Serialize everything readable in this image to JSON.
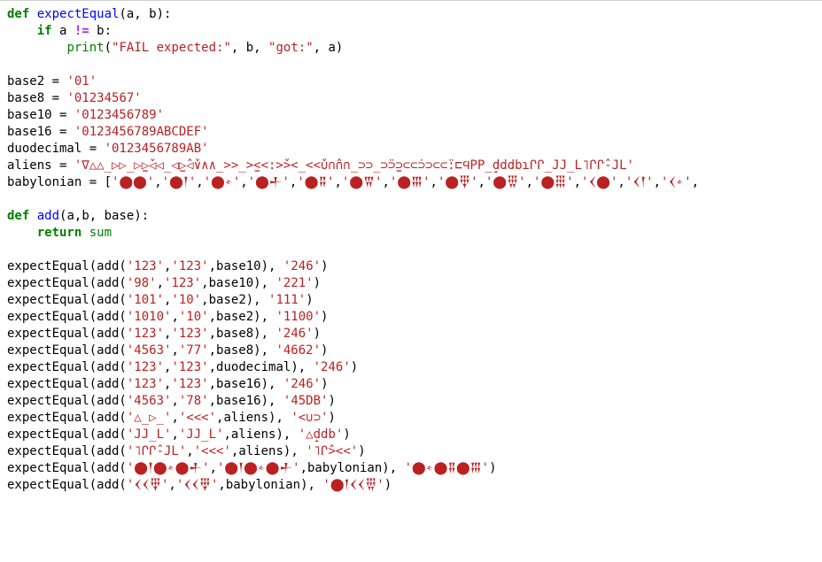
{
  "code": {
    "def1": {
      "kw_def": "def",
      "name": "expectEqual",
      "params": "(a, b):"
    },
    "if1": {
      "kw_if": "if",
      "cond_left": " a ",
      "op": "!=",
      "cond_right": " b:"
    },
    "prnt": {
      "fn": "print",
      "open": "(",
      "s1": "\"FAIL expected:\"",
      "c1": ", b, ",
      "s2": "\"got:\"",
      "c2": ", a)"
    },
    "a_base2": {
      "lhs": "base2 = ",
      "rhs": "'01'"
    },
    "a_base8": {
      "lhs": "base8 = ",
      "rhs": "'01234567'"
    },
    "a_base10": {
      "lhs": "base10 = ",
      "rhs": "'0123456789'"
    },
    "a_base16": {
      "lhs": "base16 = ",
      "rhs": "'0123456789ABCDEF'"
    },
    "a_duo": {
      "lhs": "duodecimal = ",
      "rhs": "'0123456789AB'"
    },
    "a_aliens": {
      "lhs": "aliens = ",
      "rhs": "'∇△△̲▷▷̲▷̫▷̌◁◁̲◁̫▷̂◁̌∨∧∧̲>>̲>̫<<:>̌><̲<<̌∪∩̂∩∩̲⊃⊃̲⊃̈⊃̫⊃⊂⊂̇⊃⊃⊂⊂̈:⊏ϤΡΡ̲d̝ddbɿՐՐ̲JJ̲L˥ՐՐ̂-JL'"
    },
    "a_baby": {
      "lhs": "babylonian = [",
      "items": [
        "'⬤⬤'",
        "'⬤𒑰'",
        "'⬤𒑊'",
        "'⬤𒑏'",
        "'⬤𒐉'",
        "'⬤𒐊'",
        "'⬤𒐋'",
        "'⬤𒑂'",
        "'⬤𒑄'",
        "'⬤𒑆'",
        "'𒌋⬤'",
        "'𒌋𒑰'",
        "'𒌋𒑊'"
      ],
      "tail": ","
    },
    "def2": {
      "kw_def": "def",
      "name": "add",
      "params": "(a,b, base):"
    },
    "ret": {
      "kw_ret": "return",
      "val": "sum"
    },
    "calls": [
      {
        "pre": "expectEqual(add(",
        "a": "'123'",
        "c1": ",",
        "b": "'123'",
        "c2": ",base10), ",
        "r": "'246'",
        "post": ")"
      },
      {
        "pre": "expectEqual(add(",
        "a": "'98'",
        "c1": ",",
        "b": "'123'",
        "c2": ",base10), ",
        "r": "'221'",
        "post": ")"
      },
      {
        "pre": "expectEqual(add(",
        "a": "'101'",
        "c1": ",",
        "b": "'10'",
        "c2": ",base2), ",
        "r": "'111'",
        "post": ")"
      },
      {
        "pre": "expectEqual(add(",
        "a": "'1010'",
        "c1": ",",
        "b": "'10'",
        "c2": ",base2), ",
        "r": "'1100'",
        "post": ")"
      },
      {
        "pre": "expectEqual(add(",
        "a": "'123'",
        "c1": ",",
        "b": "'123'",
        "c2": ",base8), ",
        "r": "'246'",
        "post": ")"
      },
      {
        "pre": "expectEqual(add(",
        "a": "'4563'",
        "c1": ",",
        "b": "'77'",
        "c2": ",base8), ",
        "r": "'4662'",
        "post": ")"
      },
      {
        "pre": "expectEqual(add(",
        "a": "'123'",
        "c1": ",",
        "b": "'123'",
        "c2": ",duodecimal), ",
        "r": "'246'",
        "post": ")"
      },
      {
        "pre": "expectEqual(add(",
        "a": "'123'",
        "c1": ",",
        "b": "'123'",
        "c2": ",base16), ",
        "r": "'246'",
        "post": ")"
      },
      {
        "pre": "expectEqual(add(",
        "a": "'4563'",
        "c1": ",",
        "b": "'78'",
        "c2": ",base16), ",
        "r": "'45DB'",
        "post": ")"
      },
      {
        "pre": "expectEqual(add(",
        "a": "'△̲▷̲'",
        "c1": ",",
        "b": "'<<<'",
        "c2": ",aliens), ",
        "r": "'<∪⊃'",
        "post": ")"
      },
      {
        "pre": "expectEqual(add(",
        "a": "'JJ̲L'",
        "c1": ",",
        "b": "'JJ̲L'",
        "c2": ",aliens), ",
        "r": "'△d̝db'",
        "post": ")"
      },
      {
        "pre": "expectEqual(add(",
        "a": "'˥ՐՐ̂-JL'",
        "c1": ",",
        "b": "'<<<'",
        "c2": ",aliens), ",
        "r": "'˥Ր̂><<'",
        "post": ")"
      },
      {
        "pre": "expectEqual(add(",
        "a": "'⬤𒑰⬤𒑊⬤𒑏'",
        "c1": ",",
        "b": "'⬤𒑰⬤𒑊⬤𒑏'",
        "c2": ",babylonian), ",
        "r": "'⬤𒑊⬤𒐉⬤𒐋'",
        "post": ")"
      },
      {
        "pre": "expectEqual(add(",
        "a": "'𒌋𒌋𒑂'",
        "c1": ",",
        "b": "'𒌋𒌋𒑂'",
        "c2": ",babylonian), ",
        "r": "'⬤𒑰𒌋𒌋𒑄'",
        "post": ")"
      }
    ]
  }
}
